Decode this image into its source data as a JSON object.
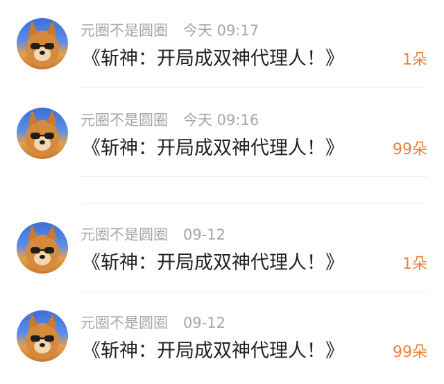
{
  "accent_color": "#e8833a",
  "messages": [
    {
      "user": "元圈不是圆圈",
      "time": "今天 09:17",
      "title": "《斩神：开局成双神代理人！》",
      "count": "1朵"
    },
    {
      "user": "元圈不是圆圈",
      "time": "今天 09:16",
      "title": "《斩神：开局成双神代理人！》",
      "count": "99朵"
    },
    {
      "user": "元圈不是圆圈",
      "time": "09-12",
      "title": "《斩神：开局成双神代理人！》",
      "count": "1朵"
    },
    {
      "user": "元圈不是圆圈",
      "time": "09-12",
      "title": "《斩神：开局成双神代理人！》",
      "count": "99朵"
    }
  ]
}
